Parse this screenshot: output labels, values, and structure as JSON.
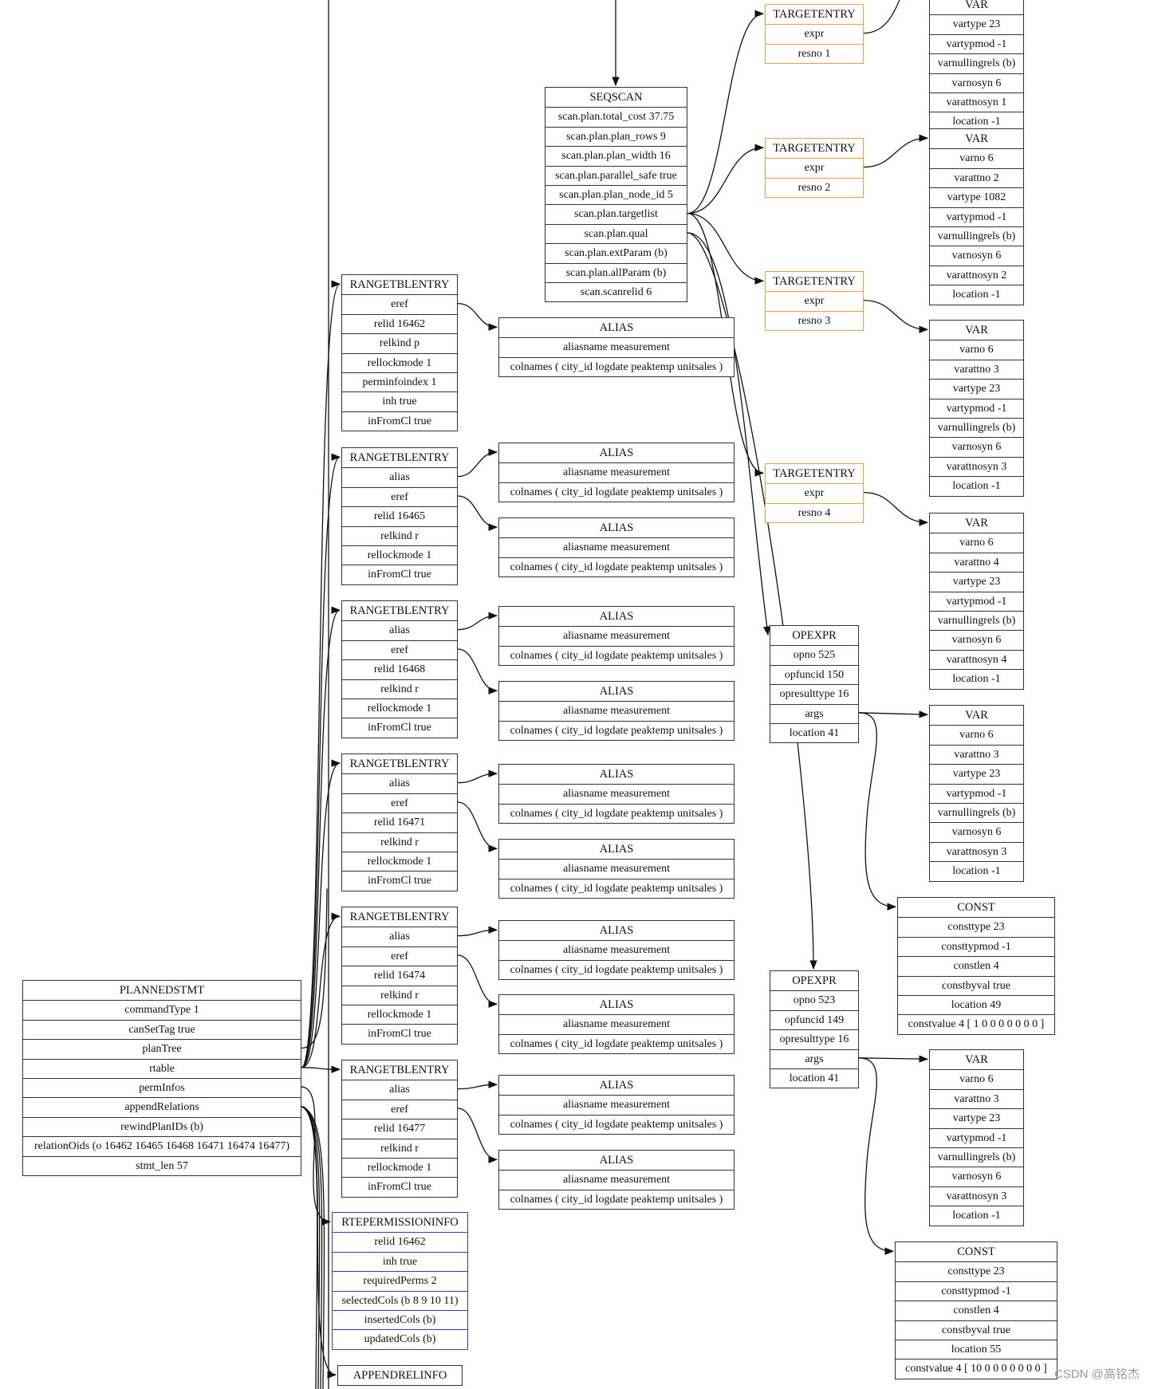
{
  "watermark": "CSDN @高铭杰",
  "colors": {
    "default_border": "#333333",
    "targetentry_border": "#f0a030",
    "rtepermission_border": "#3838c8",
    "edge": "#111111"
  },
  "nodes": {
    "plannedstmt": {
      "title": "PLANNEDSTMT",
      "fields": [
        "commandType 1",
        "canSetTag true",
        "planTree",
        "rtable",
        "permInfos",
        "appendRelations",
        "rewindPlanIDs (b)",
        "relationOids (o 16462 16465 16468 16471 16474 16477)",
        "stmt_len 57"
      ]
    },
    "seqscan": {
      "title": "SEQSCAN",
      "fields": [
        "scan.plan.total_cost 37.75",
        "scan.plan.plan_rows 9",
        "scan.plan.plan_width 16",
        "scan.plan.parallel_safe true",
        "scan.plan.plan_node_id 5",
        "scan.plan.targetlist",
        "scan.plan.qual",
        "scan.plan.extParam (b)",
        "scan.plan.allParam (b)",
        "scan.scanrelid 6"
      ]
    },
    "rte1": {
      "title": "RANGETBLENTRY",
      "fields": [
        "eref",
        "relid 16462",
        "relkind p",
        "rellockmode 1",
        "perminfoindex 1",
        "inh true",
        "inFromCl true"
      ]
    },
    "rte2": {
      "title": "RANGETBLENTRY",
      "fields": [
        "alias",
        "eref",
        "relid 16465",
        "relkind r",
        "rellockmode 1",
        "inFromCl true"
      ]
    },
    "rte3": {
      "title": "RANGETBLENTRY",
      "fields": [
        "alias",
        "eref",
        "relid 16468",
        "relkind r",
        "rellockmode 1",
        "inFromCl true"
      ]
    },
    "rte4": {
      "title": "RANGETBLENTRY",
      "fields": [
        "alias",
        "eref",
        "relid 16471",
        "relkind r",
        "rellockmode 1",
        "inFromCl true"
      ]
    },
    "rte5": {
      "title": "RANGETBLENTRY",
      "fields": [
        "alias",
        "eref",
        "relid 16474",
        "relkind r",
        "rellockmode 1",
        "inFromCl true"
      ]
    },
    "rte6": {
      "title": "RANGETBLENTRY",
      "fields": [
        "alias",
        "eref",
        "relid 16477",
        "relkind r",
        "rellockmode 1",
        "inFromCl true"
      ]
    },
    "alias1": {
      "title": "ALIAS",
      "fields": [
        "aliasname measurement",
        "colnames ( city_id logdate peaktemp unitsales )"
      ]
    },
    "alias2a": {
      "title": "ALIAS",
      "fields": [
        "aliasname measurement",
        "colnames ( city_id logdate peaktemp unitsales )"
      ]
    },
    "alias2b": {
      "title": "ALIAS",
      "fields": [
        "aliasname measurement",
        "colnames ( city_id logdate peaktemp unitsales )"
      ]
    },
    "alias3a": {
      "title": "ALIAS",
      "fields": [
        "aliasname measurement",
        "colnames ( city_id logdate peaktemp unitsales )"
      ]
    },
    "alias3b": {
      "title": "ALIAS",
      "fields": [
        "aliasname measurement",
        "colnames ( city_id logdate peaktemp unitsales )"
      ]
    },
    "alias4a": {
      "title": "ALIAS",
      "fields": [
        "aliasname measurement",
        "colnames ( city_id logdate peaktemp unitsales )"
      ]
    },
    "alias4b": {
      "title": "ALIAS",
      "fields": [
        "aliasname measurement",
        "colnames ( city_id logdate peaktemp unitsales )"
      ]
    },
    "alias5a": {
      "title": "ALIAS",
      "fields": [
        "aliasname measurement",
        "colnames ( city_id logdate peaktemp unitsales )"
      ]
    },
    "alias5b": {
      "title": "ALIAS",
      "fields": [
        "aliasname measurement",
        "colnames ( city_id logdate peaktemp unitsales )"
      ]
    },
    "alias6a": {
      "title": "ALIAS",
      "fields": [
        "aliasname measurement",
        "colnames ( city_id logdate peaktemp unitsales )"
      ]
    },
    "alias6b": {
      "title": "ALIAS",
      "fields": [
        "aliasname measurement",
        "colnames ( city_id logdate peaktemp unitsales )"
      ]
    },
    "te1": {
      "title": "TARGETENTRY",
      "fields": [
        "expr",
        "resno 1"
      ]
    },
    "te2": {
      "title": "TARGETENTRY",
      "fields": [
        "expr",
        "resno 2"
      ]
    },
    "te3": {
      "title": "TARGETENTRY",
      "fields": [
        "expr",
        "resno 3"
      ]
    },
    "te4": {
      "title": "TARGETENTRY",
      "fields": [
        "expr",
        "resno 4"
      ]
    },
    "var1": {
      "title": "VAR",
      "fields": [
        "vartype 23",
        "vartypmod -1",
        "varnullingrels (b)",
        "varnosyn 6",
        "varattnosyn 1",
        "location -1"
      ]
    },
    "var2": {
      "title": "VAR",
      "fields": [
        "varno 6",
        "varattno 2",
        "vartype 1082",
        "vartypmod -1",
        "varnullingrels (b)",
        "varnosyn 6",
        "varattnosyn 2",
        "location -1"
      ]
    },
    "var3": {
      "title": "VAR",
      "fields": [
        "varno 6",
        "varattno 3",
        "vartype 23",
        "vartypmod -1",
        "varnullingrels (b)",
        "varnosyn 6",
        "varattnosyn 3",
        "location -1"
      ]
    },
    "var4": {
      "title": "VAR",
      "fields": [
        "varno 6",
        "varattno 4",
        "vartype 23",
        "vartypmod -1",
        "varnullingrels (b)",
        "varnosyn 6",
        "varattnosyn 4",
        "location -1"
      ]
    },
    "opexpr1": {
      "title": "OPEXPR",
      "fields": [
        "opno 525",
        "opfuncid 150",
        "opresulttype 16",
        "args",
        "location 41"
      ]
    },
    "var5": {
      "title": "VAR",
      "fields": [
        "varno 6",
        "varattno 3",
        "vartype 23",
        "vartypmod -1",
        "varnullingrels (b)",
        "varnosyn 6",
        "varattnosyn 3",
        "location -1"
      ]
    },
    "const1": {
      "title": "CONST",
      "fields": [
        "consttype 23",
        "consttypmod -1",
        "constlen 4",
        "constbyval true",
        "location 49",
        "constvalue 4 [ 1 0 0 0 0 0 0 0 ]"
      ]
    },
    "opexpr2": {
      "title": "OPEXPR",
      "fields": [
        "opno 523",
        "opfuncid 149",
        "opresulttype 16",
        "args",
        "location 41"
      ]
    },
    "var6": {
      "title": "VAR",
      "fields": [
        "varno 6",
        "varattno 3",
        "vartype 23",
        "vartypmod -1",
        "varnullingrels (b)",
        "varnosyn 6",
        "varattnosyn 3",
        "location -1"
      ]
    },
    "const2": {
      "title": "CONST",
      "fields": [
        "consttype 23",
        "consttypmod -1",
        "constlen 4",
        "constbyval true",
        "location 55",
        "constvalue 4 [ 10 0 0 0 0 0 0 0 ]"
      ]
    },
    "rtepermission": {
      "title": "RTEPERMISSIONINFO",
      "fields": [
        "relid 16462",
        "inh true",
        "requiredPerms 2",
        "selectedCols (b 8 9 10 11)",
        "insertedCols (b)",
        "updatedCols (b)"
      ]
    },
    "appendrelinfo": {
      "title": "APPENDRELINFO",
      "fields": []
    }
  }
}
